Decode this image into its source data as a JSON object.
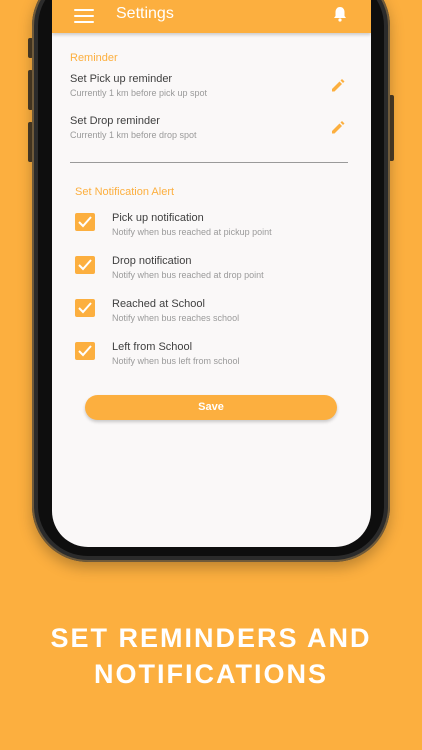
{
  "appbar": {
    "title": "Settings",
    "menu_icon": "hamburger-menu-icon",
    "bell_icon": "bell-icon"
  },
  "reminder": {
    "section_label": "Reminder",
    "items": [
      {
        "title": "Set Pick up reminder",
        "subtitle": "Currently 1 km before pick up spot",
        "icon": "edit-pencil-icon"
      },
      {
        "title": "Set Drop reminder",
        "subtitle": "Currently 1 km before drop spot",
        "icon": "edit-pencil-icon"
      }
    ]
  },
  "notifications": {
    "section_label": "Set Notification Alert",
    "items": [
      {
        "title": "Pick up notification",
        "subtitle": "Notify when bus reached at pickup point",
        "checked": true
      },
      {
        "title": "Drop notification",
        "subtitle": "Notify when bus reached at drop point",
        "checked": true
      },
      {
        "title": "Reached at School",
        "subtitle": "Notify when bus reaches school",
        "checked": true
      },
      {
        "title": "Left from School",
        "subtitle": "Notify when bus left from school",
        "checked": true
      }
    ]
  },
  "save_label": "Save",
  "caption": {
    "line1": "SET REMINDERS AND",
    "line2": "NOTIFICATIONS"
  },
  "colors": {
    "accent": "#FCAF3F",
    "screen_bg": "#FAF8F8"
  }
}
